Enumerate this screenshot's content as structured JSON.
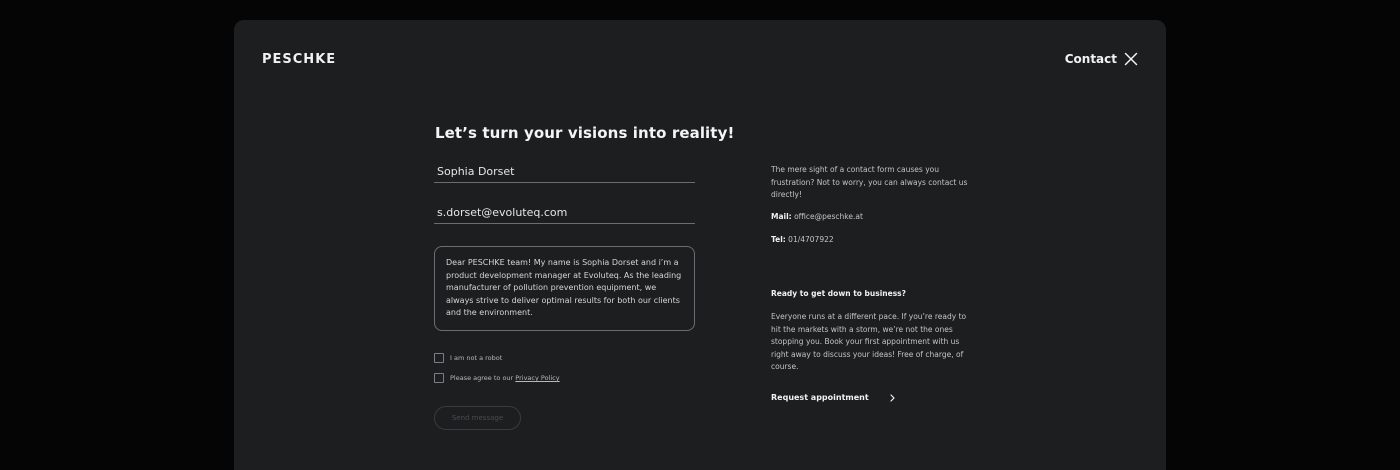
{
  "header": {
    "logo": "PESCHKE",
    "contact_label": "Contact",
    "close_icon": "close-icon"
  },
  "form": {
    "headline": "Let’s turn your visions into reality!",
    "name_value": "Sophia Dorset",
    "email_value": "s.dorset@evoluteq.com",
    "message_value": "Dear PESCHKE team! My name is Sophia Dorset and i’m a product development manager at Evoluteq. As the leading manufacturer of pollution prevention equipment, we always strive to deliver optimal results for both our clients and the environment.",
    "robot_label": "I am not a robot",
    "privacy_prefix": "Please agree to our ",
    "privacy_link": "Privacy Policy",
    "send_label": "Send message"
  },
  "sidebar": {
    "intro": "The mere sight of a contact form causes you frustration? Not to worry, you can always contact us directly!",
    "mail_label": "Mail:",
    "mail_value": "office@peschke.at",
    "tel_label": "Tel:",
    "tel_value": "01/4707922",
    "heading": "Ready to get down to business?",
    "body": "Everyone runs at a different pace. If you’re ready to hit the markets with a storm, we’re not the ones stopping you. Book your first appointment with us right away to discuss your ideas! Free of charge, of course.",
    "request_label": "Request appointment",
    "request_icon": "chevron-right-icon"
  },
  "colors": {
    "page_background": "#050506",
    "panel_background": "#1d1e20",
    "text_primary": "#f2f2f2",
    "line": "#6c6d70"
  }
}
